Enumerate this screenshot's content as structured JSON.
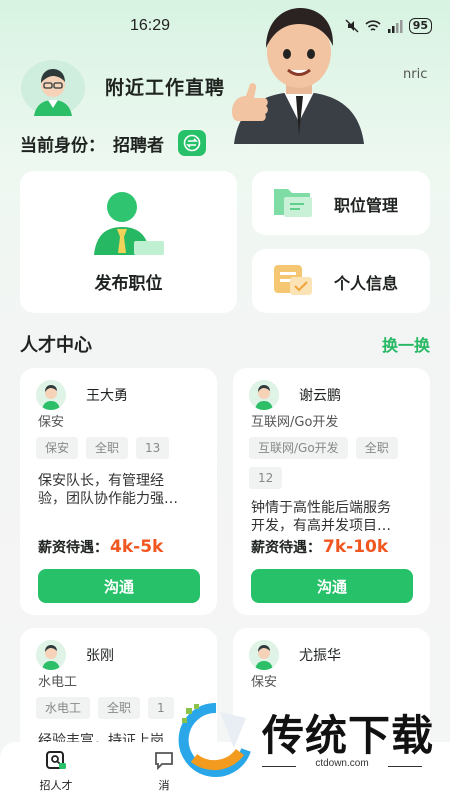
{
  "status_bar": {
    "time": "16:29",
    "battery": "95"
  },
  "header": {
    "title": "附近工作直聘",
    "side_text": "nric",
    "role_label": "当前身份：",
    "role_value": "招聘者"
  },
  "actions": {
    "publish": "发布职位",
    "manage": "职位管理",
    "profile": "个人信息"
  },
  "talent_center": {
    "title": "人才中心",
    "refresh": "换一换"
  },
  "salary_label": "薪资待遇：",
  "talents": [
    {
      "name": "王大勇",
      "role": "保安",
      "tags": [
        "保安",
        "全职",
        "13"
      ],
      "desc_line1": "保安队长，有管理经",
      "desc_line2": "验，团队协作能力强…",
      "salary": "4k-5k",
      "button": "沟通"
    },
    {
      "name": "谢云鹏",
      "role": "互联网/Go开发",
      "tags": [
        "互联网/Go开发",
        "全职",
        "12"
      ],
      "desc_line1": "钟情于高性能后端服务",
      "desc_line2": "开发，有高并发项目…",
      "salary": "7k-10k",
      "button": "沟通"
    },
    {
      "name": "张刚",
      "role": "水电工",
      "tags": [
        "水电工",
        "全职",
        "1"
      ],
      "desc_line1": "经验丰富，持证上岗"
    },
    {
      "name": "尤振华",
      "role": "保安"
    }
  ],
  "nav": {
    "recruit": "招人才",
    "messages": "消"
  },
  "watermark": {
    "brand": "传统下载",
    "url": "ctdown.com"
  },
  "colors": {
    "accent": "#27c16a",
    "salary": "#f0561f"
  }
}
